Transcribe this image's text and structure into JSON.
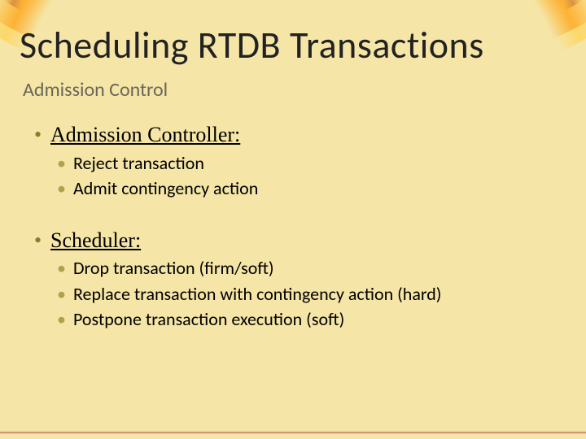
{
  "title": "Scheduling RTDB Transactions",
  "subtitle": "Admission Control",
  "sections": [
    {
      "heading": "Admission Controller:",
      "items": [
        "Reject transaction",
        "Admit contingency action"
      ]
    },
    {
      "heading": "Scheduler:",
      "items": [
        "Drop transaction (firm/soft)",
        "Replace transaction with contingency action (hard)",
        "Postpone transaction execution (soft)"
      ]
    }
  ]
}
